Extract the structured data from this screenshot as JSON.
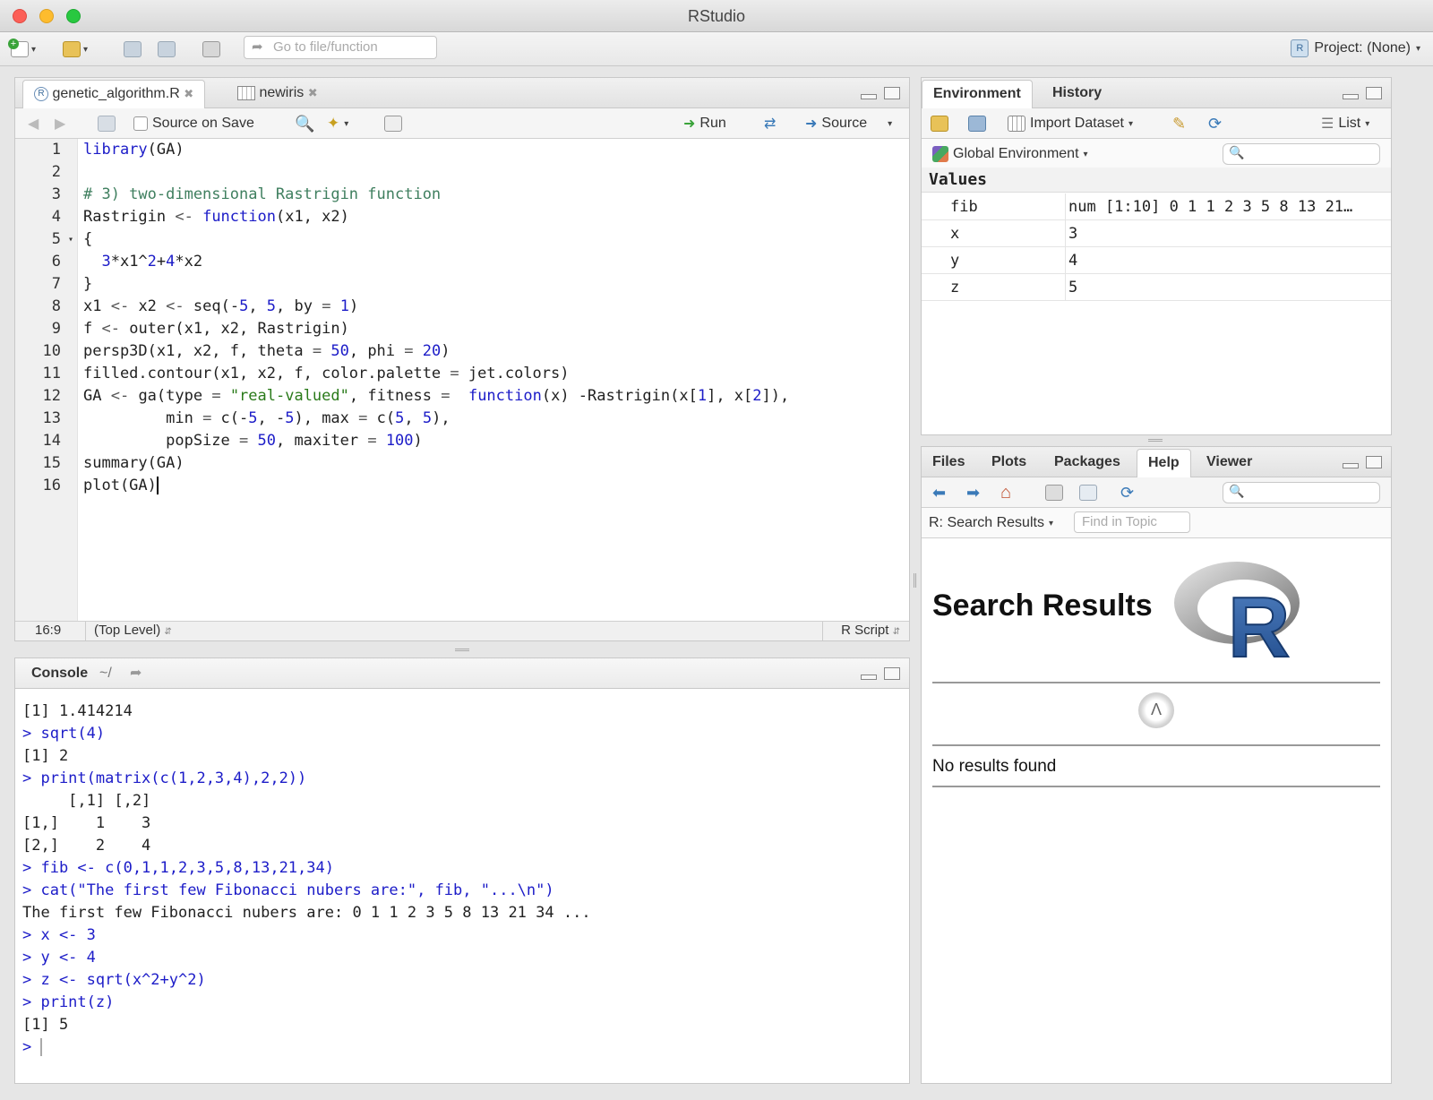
{
  "window": {
    "title": "RStudio"
  },
  "toolbar": {
    "goto_placeholder": "Go to file/function",
    "project_label": "Project: (None)"
  },
  "editor": {
    "tabs": [
      {
        "label": "genetic_algorithm.R"
      },
      {
        "label": "newiris"
      }
    ],
    "source_on_save": "Source on Save",
    "run_label": "Run",
    "source_label": "Source",
    "line_numbers": [
      "1",
      "2",
      "3",
      "4",
      "5",
      "6",
      "7",
      "8",
      "9",
      "10",
      "11",
      "12",
      "13",
      "14",
      "15",
      "16"
    ],
    "status": {
      "position": "16:9",
      "scope": "(Top Level)",
      "file_type": "R Script"
    }
  },
  "console": {
    "title": "Console",
    "path": "~/",
    "lines": [
      {
        "text": "[1] 1.414214",
        "kind": "out"
      },
      {
        "text": "> sqrt(4)",
        "kind": "in"
      },
      {
        "text": "[1] 2",
        "kind": "out"
      },
      {
        "text": "> print(matrix(c(1,2,3,4),2,2))",
        "kind": "in"
      },
      {
        "text": "     [,1] [,2]",
        "kind": "out"
      },
      {
        "text": "[1,]    1    3",
        "kind": "out"
      },
      {
        "text": "[2,]    2    4",
        "kind": "out"
      },
      {
        "text": "> fib <- c(0,1,1,2,3,5,8,13,21,34)",
        "kind": "in"
      },
      {
        "text": "> cat(\"The first few Fibonacci nubers are:\", fib, \"...\\n\")",
        "kind": "in"
      },
      {
        "text": "The first few Fibonacci nubers are: 0 1 1 2 3 5 8 13 21 34 ...",
        "kind": "out"
      },
      {
        "text": "> x <- 3",
        "kind": "in"
      },
      {
        "text": "> y <- 4",
        "kind": "in"
      },
      {
        "text": "> z <- sqrt(x^2+y^2)",
        "kind": "in"
      },
      {
        "text": "> print(z)",
        "kind": "in"
      },
      {
        "text": "[1] 5",
        "kind": "out"
      }
    ],
    "prompt": ">"
  },
  "environment": {
    "tabs": [
      {
        "label": "Environment"
      },
      {
        "label": "History"
      }
    ],
    "import_dataset": "Import Dataset",
    "view_mode": "List",
    "scope": "Global Environment",
    "section": "Values",
    "rows": [
      {
        "name": "fib",
        "value": "num [1:10] 0 1 1 2 3 5 8 13 21…"
      },
      {
        "name": "x",
        "value": "3"
      },
      {
        "name": "y",
        "value": "4"
      },
      {
        "name": "z",
        "value": "5"
      }
    ]
  },
  "files": {
    "tabs": [
      {
        "label": "Files"
      },
      {
        "label": "Plots"
      },
      {
        "label": "Packages"
      },
      {
        "label": "Help"
      },
      {
        "label": "Viewer"
      }
    ],
    "help_nav": "R: Search Results",
    "find_placeholder": "Find in Topic",
    "heading": "Search Results",
    "logo_letter": "R",
    "message": "No results found"
  }
}
